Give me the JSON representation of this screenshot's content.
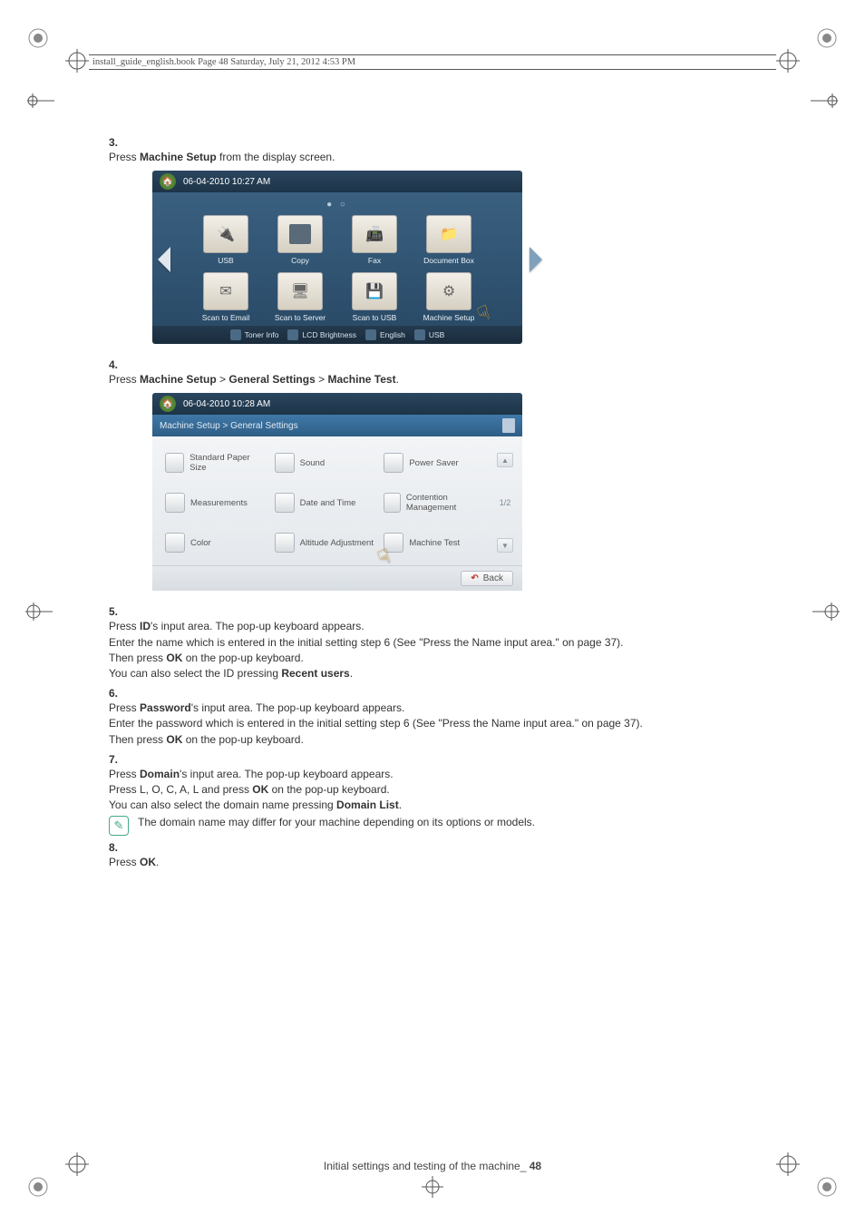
{
  "header": {
    "running": "install_guide_english.book  Page 48  Saturday, July 21, 2012  4:53 PM"
  },
  "steps": {
    "s3": {
      "num": "3.",
      "t1a": "Press ",
      "t1b": "Machine Setup",
      "t1c": " from the display screen."
    },
    "s4": {
      "num": "4.",
      "t1a": "Press ",
      "t1b": "Machine Setup",
      "t1c": " > ",
      "t1d": "General Settings",
      "t1e": " > ",
      "t1f": "Machine Test",
      "t1g": "."
    },
    "s5": {
      "num": "5.",
      "l1a": "Press ",
      "l1b": "ID",
      "l1c": "'s input area. The pop-up keyboard appears.",
      "l2": "Enter the name which is entered in the initial setting step 6 (See \"Press the Name input area.\" on page 37).",
      "l3a": "Then press ",
      "l3b": "OK",
      "l3c": " on the pop-up keyboard.",
      "l4a": "You can also select the ID pressing ",
      "l4b": "Recent users",
      "l4c": "."
    },
    "s6": {
      "num": "6.",
      "l1a": "Press ",
      "l1b": "Password",
      "l1c": "'s input area. The pop-up keyboard appears.",
      "l2": "Enter the password which is entered in the initial setting step 6 (See \"Press the Name input area.\" on page 37).",
      "l3a": "Then press ",
      "l3b": "OK",
      "l3c": " on the pop-up keyboard."
    },
    "s7": {
      "num": "7.",
      "l1a": "Press ",
      "l1b": "Domain",
      "l1c": "'s input area. The pop-up keyboard appears.",
      "l2a": "Press L, O, C, A, L and press ",
      "l2b": "OK",
      "l2c": " on the pop-up keyboard.",
      "l3a": "You can also select the domain name pressing ",
      "l3b": "Domain List",
      "l3c": ".",
      "note": "The domain name may differ for your machine depending on its options or models."
    },
    "s8": {
      "num": "8.",
      "t1a": "Press ",
      "t1b": "OK",
      "t1c": "."
    }
  },
  "screenA": {
    "time": "06-04-2010 10:27 AM",
    "tiles": [
      "USB",
      "Copy",
      "Fax",
      "Document Box",
      "Scan to Email",
      "Scan to Server",
      "Scan to USB",
      "Machine Setup"
    ],
    "footer": [
      "Toner Info",
      "LCD Brightness",
      "English",
      "USB"
    ]
  },
  "screenB": {
    "time": "06-04-2010 10:28 AM",
    "crumb": "Machine Setup > General Settings",
    "options": [
      "Standard Paper Size",
      "Sound",
      "Power Saver",
      "Measurements",
      "Date and Time",
      "Contention Management",
      "Color",
      "Altitude Adjustment",
      "Machine Test"
    ],
    "page": "1/2",
    "back": "Back"
  },
  "footer": {
    "section": "Initial settings and testing of the machine",
    "sep": "_ ",
    "page": "48"
  }
}
